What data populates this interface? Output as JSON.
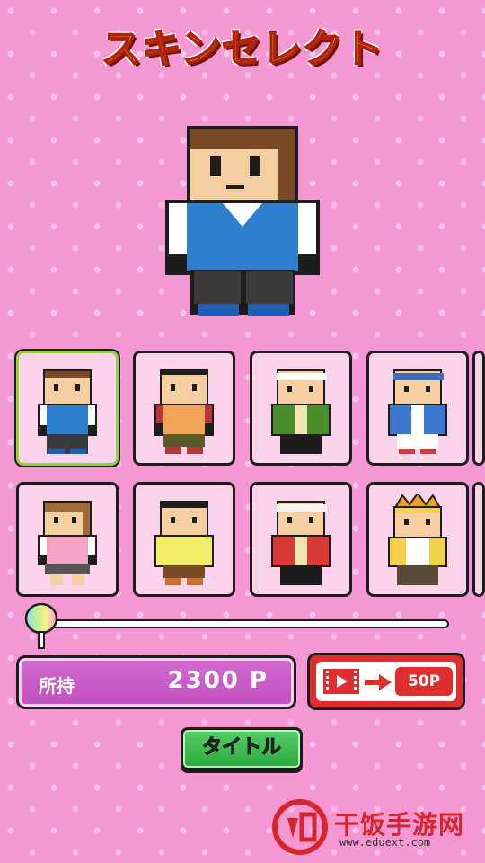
{
  "screen": {
    "title": "スキンセレクト"
  },
  "preview": {
    "skin": "student-blue-vest"
  },
  "skins": [
    {
      "name": "student-blue-vest",
      "selected": true,
      "hair": "#7a4a27",
      "shirt": "#2f7fcf",
      "pants": "#3a3a3a",
      "sleeves": "#ffffff",
      "shoes": "#1d5fb0"
    },
    {
      "name": "orange-polo",
      "selected": false,
      "hair": "#1d1d1d",
      "shirt": "#f2a456",
      "pants": "#5b5b2a",
      "sleeves": "#b6373a",
      "shoes": "#b6373a"
    },
    {
      "name": "green-happi",
      "selected": false,
      "hair": "#ffffff",
      "shirt": "#4b8f2c",
      "pants": "#1d1d1d",
      "sleeves": "#4b8f2c",
      "shoes": "#1d1d1d"
    },
    {
      "name": "blue-happi",
      "selected": false,
      "hair": "#3c6fb5",
      "shirt": "#3c78d0",
      "pants": "#ffffff",
      "sleeves": "#3c78d0",
      "shoes": "#c94040"
    },
    {
      "name": "pink-girl",
      "selected": false,
      "hair": "#a06a3a",
      "shirt": "#f3a3c4",
      "pants": "#555555",
      "sleeves": "#ffffff",
      "shoes": "#1d1d1d"
    },
    {
      "name": "yellow-tracksuit",
      "selected": false,
      "hair": "#1d1d1d",
      "shirt": "#f2ee6a",
      "pants": "#7a4a27",
      "sleeves": "#f2ee6a",
      "shoes": "#c97030"
    },
    {
      "name": "red-happi",
      "selected": false,
      "hair": "#f5f5f5",
      "shirt": "#d93a3a",
      "pants": "#1d1d1d",
      "sleeves": "#d93a3a",
      "shoes": "#1d1d1d"
    },
    {
      "name": "golden-armor",
      "selected": false,
      "hair": "#f0a020",
      "shirt": "#f2d24a",
      "pants": "#5a4a3a",
      "sleeves": "#f2d24a",
      "shoes": "#8a5a2a"
    }
  ],
  "slider": {
    "position": 0.0
  },
  "points": {
    "label": "所持",
    "value": "2300 P"
  },
  "video_reward": {
    "label": "50P"
  },
  "title_button": {
    "label": "タイトル"
  },
  "watermark": {
    "text": "干饭手游网",
    "url": "www.eduext.com"
  },
  "colors": {
    "background": "#f497d3",
    "title_fill": "#ffd23a",
    "selected_border": "#8fd23c",
    "points_panel": "#c95bc8",
    "video_button": "#e02d2d",
    "title_button": "#3dbb50"
  }
}
